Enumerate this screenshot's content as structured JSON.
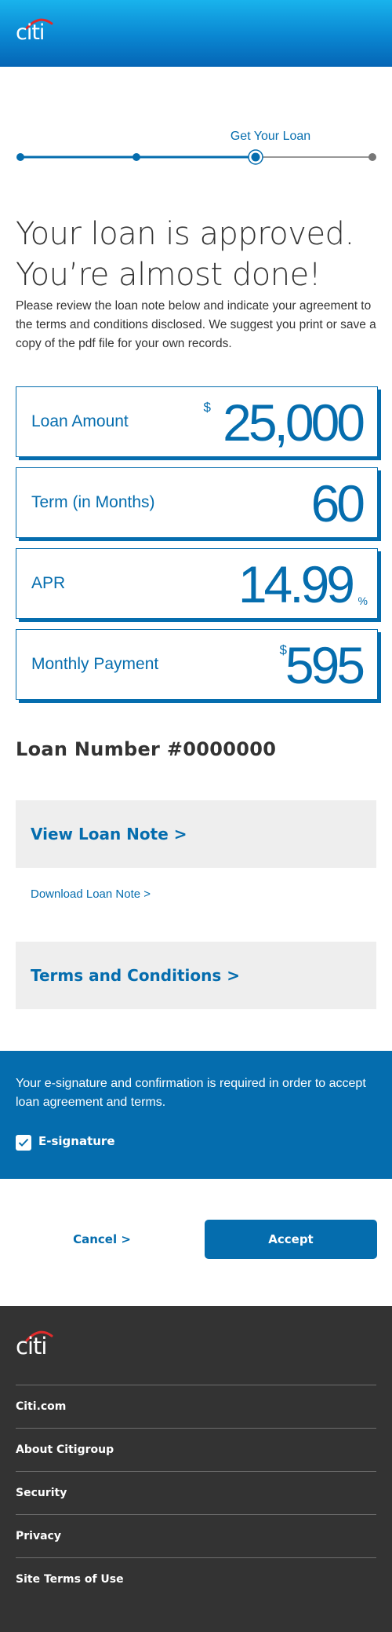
{
  "brand": {
    "logo_text": "citi",
    "primary_color": "#056dae",
    "arc_color": "#e12b2b"
  },
  "progress": {
    "current_step_label": "Get Your Loan",
    "steps_total": 4,
    "current_step": 3
  },
  "headline": {
    "line1": "Your loan is approved.",
    "line2": "You’re almost done!"
  },
  "intro": "Please review the loan note below and indicate your agreement to the terms and conditions disclosed. We suggest you print or save a copy of the pdf file for your own records.",
  "cards": [
    {
      "label": "Loan Amount",
      "prefix": "$",
      "value": "25,000",
      "suffix": ""
    },
    {
      "label": "Term (in Months)",
      "prefix": "",
      "value": "60",
      "suffix": ""
    },
    {
      "label": "APR",
      "prefix": "",
      "value": "14.99",
      "suffix": "%"
    },
    {
      "label": "Monthly Payment",
      "prefix": "$",
      "value": "595",
      "suffix": ""
    }
  ],
  "loan_number": "Loan Number #0000000",
  "links": {
    "view_note": "View Loan Note >",
    "download_note": "Download Loan Note >",
    "terms": "Terms and Conditions >"
  },
  "esignature": {
    "message": "Your e-signature and confirmation is required in order to accept loan agreement and terms.",
    "checkbox_label": "E-signature",
    "checked": true
  },
  "actions": {
    "cancel": "Cancel >",
    "accept": "Accept"
  },
  "footer": {
    "logo_text": "citi",
    "links": [
      "Citi.com",
      "About Citigroup",
      "Security",
      "Privacy",
      "Site Terms of Use"
    ]
  }
}
